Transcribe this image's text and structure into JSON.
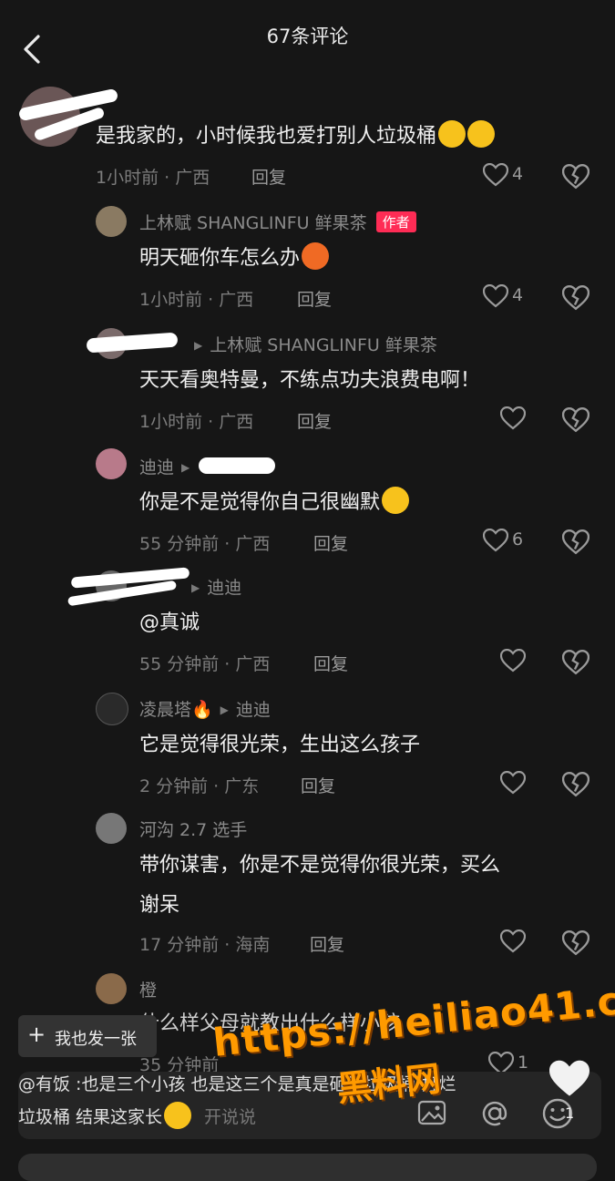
{
  "header": {
    "title": "67条评论"
  },
  "comments": [
    {
      "name": "",
      "text": "是我家的，小时候我也爱打别人垃圾桶",
      "time": "1小时前 · 广西",
      "reply": "回复",
      "likes": "4"
    },
    {
      "name": "上林赋 SHANGLINFU 鲜果茶",
      "badge": "作者",
      "text": "明天砸你车怎么办",
      "time": "1小时前 · 广西",
      "reply": "回复",
      "likes": "4"
    },
    {
      "name": "",
      "to": "上林赋 SHANGLINFU 鲜果茶",
      "text": "天天看奥特曼，不练点功夫浪费电啊！",
      "time": "1小时前 · 广西",
      "reply": "回复",
      "likes": ""
    },
    {
      "name": "迪迪",
      "to": "",
      "text": "你是不是觉得你自己很幽默",
      "time": "55 分钟前 · 广西",
      "reply": "回复",
      "likes": "6"
    },
    {
      "name": "",
      "to": "迪迪",
      "text": "@真诚",
      "time": "55 分钟前 · 广西",
      "reply": "回复",
      "likes": ""
    },
    {
      "name": "凌晨塔🔥",
      "to": "迪迪",
      "text": "它是觉得很光荣，生出这么孩子",
      "time": "2 分钟前 · 广东",
      "reply": "回复",
      "likes": ""
    },
    {
      "name": "河沟 2.7 选手",
      "text1": "带你谋害，你是不是觉得你很光荣，买么",
      "text2": "谢呆",
      "time": "17 分钟前 · 海南",
      "reply": "回复",
      "likes": ""
    },
    {
      "name": "橙",
      "text": "什么样父母就教出什么样小孩",
      "time": "35 分钟前",
      "likes": "1"
    }
  ],
  "post_button": {
    "label": "我也发一张"
  },
  "input": {
    "line1": "@有饭 :也是三个小孩 也是这三个是真是砸坏垃圾桶 打烂",
    "line2": "垃圾桶 结果这家长",
    "placeholder": "开说说"
  },
  "float_like_count": "1",
  "watermark": {
    "url": "https://heiliao41.com",
    "cn": "黑料网"
  },
  "colors": {
    "accent": "#fe2c55",
    "watermark": "#ff9a00"
  }
}
